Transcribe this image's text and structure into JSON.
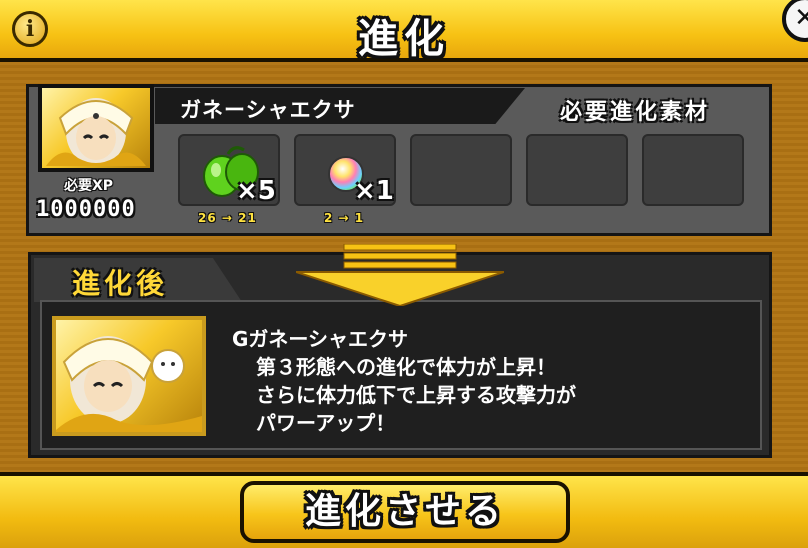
{
  "header": {
    "title": "進化",
    "info_icon": "info-icon",
    "close_icon": "close-icon"
  },
  "unit": {
    "name": "ガネーシャエクサ",
    "required_materials_label": "必要進化素材"
  },
  "xp": {
    "label": "必要XP",
    "value": "1000000"
  },
  "materials": [
    {
      "icon": "green-fruit-icon",
      "quantity": "×5",
      "change": "26 → 21"
    },
    {
      "icon": "rainbow-orb-icon",
      "quantity": "×1",
      "change": "2 → 1"
    },
    {
      "icon": "",
      "quantity": "",
      "change": ""
    },
    {
      "icon": "",
      "quantity": "",
      "change": ""
    },
    {
      "icon": "",
      "quantity": "",
      "change": ""
    }
  ],
  "after": {
    "label": "進化後",
    "name": "Gガネーシャエクサ",
    "lines": [
      "第３形態への進化で体力が上昇！",
      "さらに体力低下で上昇する攻撃力が",
      "パワーアップ！"
    ]
  },
  "footer": {
    "evolve_button": "進化させる"
  },
  "colors": {
    "accent": "#f7c214",
    "panel": "#5a5a5a",
    "dark": "#2a2a2a"
  }
}
